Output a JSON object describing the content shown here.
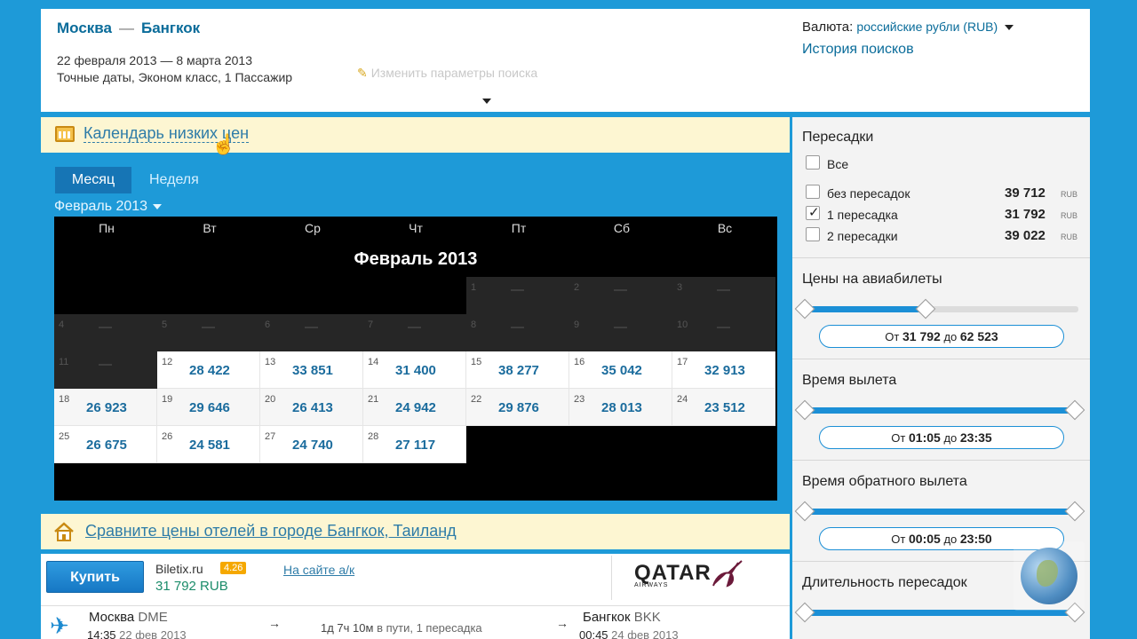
{
  "header": {
    "origin": "Москва",
    "sep": "—",
    "destination": "Бангкок",
    "dates": "22 февраля 2013 — 8 марта 2013",
    "details": "Точные даты, Эконом класс, 1 Пассажир",
    "edit_label": "Изменить параметры поиска",
    "currency_label": "Валюта:",
    "currency_value": "российские рубли (RUB)",
    "history_label": "История поисков"
  },
  "calendar_link": "Календарь низких цен",
  "tabs": {
    "month": "Месяц",
    "week": "Неделя"
  },
  "month_selector": "Февраль 2013",
  "calendar": {
    "title": "Февраль 2013",
    "weekdays": [
      "Пн",
      "Вт",
      "Ср",
      "Чт",
      "Пт",
      "Сб",
      "Вс"
    ],
    "empty_price": "—",
    "rows": [
      [
        null,
        null,
        null,
        null,
        {
          "d": "1",
          "p": null
        },
        {
          "d": "2",
          "p": null
        },
        {
          "d": "3",
          "p": null
        }
      ],
      [
        {
          "d": "4",
          "p": null
        },
        {
          "d": "5",
          "p": null
        },
        {
          "d": "6",
          "p": null
        },
        {
          "d": "7",
          "p": null
        },
        {
          "d": "8",
          "p": null
        },
        {
          "d": "9",
          "p": null
        },
        {
          "d": "10",
          "p": null
        }
      ],
      [
        {
          "d": "11",
          "p": null
        },
        {
          "d": "12",
          "p": "28 422"
        },
        {
          "d": "13",
          "p": "33 851"
        },
        {
          "d": "14",
          "p": "31 400"
        },
        {
          "d": "15",
          "p": "38 277"
        },
        {
          "d": "16",
          "p": "35 042"
        },
        {
          "d": "17",
          "p": "32 913"
        }
      ],
      [
        {
          "d": "18",
          "p": "26 923"
        },
        {
          "d": "19",
          "p": "29 646"
        },
        {
          "d": "20",
          "p": "26 413"
        },
        {
          "d": "21",
          "p": "24 942"
        },
        {
          "d": "22",
          "p": "29 876"
        },
        {
          "d": "23",
          "p": "28 013"
        },
        {
          "d": "24",
          "p": "23 512"
        }
      ],
      [
        {
          "d": "25",
          "p": "26 675"
        },
        {
          "d": "26",
          "p": "24 581"
        },
        {
          "d": "27",
          "p": "24 740"
        },
        {
          "d": "28",
          "p": "27 117"
        },
        null,
        null,
        null
      ]
    ]
  },
  "hotels_link": "Сравните цены отелей в городе Бангкок, Таиланд",
  "result": {
    "buy_label": "Купить",
    "agency": "Biletix.ru",
    "rating": "4.26",
    "price": "31 792 RUB",
    "onsite_label": "На сайте а/к",
    "airline": "QATAR",
    "airline_sub": "AIRWAYS",
    "dep_city": "Москва",
    "dep_code": "DME",
    "dep_time": "14:35",
    "dep_date": "22 фев 2013",
    "arrow": "→",
    "duration": "1д 7ч 10м",
    "duration_note": "в пути, 1 пересадка",
    "arr_city": "Бангкок",
    "arr_code": "BKK",
    "arr_time": "00:45",
    "arr_date": "24 фев 2013"
  },
  "sidebar": {
    "stops_title": "Пересадки",
    "stops_all": "Все",
    "stops": [
      {
        "label": "без пересадок",
        "price": "39 712",
        "unit": "RUB",
        "checked": false
      },
      {
        "label": "1 пересадка",
        "price": "31 792",
        "unit": "RUB",
        "checked": true
      },
      {
        "label": "2 пересадки",
        "price": "39 022",
        "unit": "RUB",
        "checked": false
      }
    ],
    "price_title": "Цены на авиабилеты",
    "price_from_word": "От",
    "price_min": "31 792",
    "price_to_word": "до",
    "price_max": "62 523",
    "price_fill_fraction": 0.44,
    "dep_title": "Время вылета",
    "dep_from": "01:05",
    "dep_to": "23:35",
    "ret_title": "Время обратного вылета",
    "ret_from": "00:05",
    "ret_to": "23:50",
    "layover_title": "Длительность пересадок",
    "accent_color": "#1b8fd6"
  }
}
